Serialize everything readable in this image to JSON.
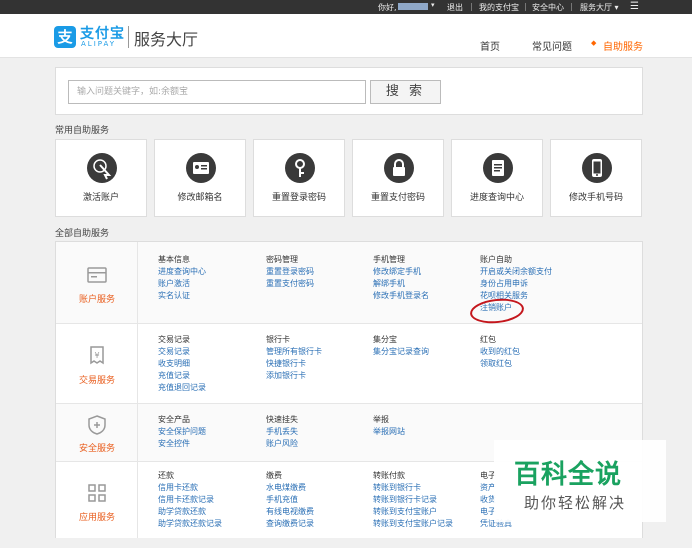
{
  "topbar": {
    "greeting": "你好,",
    "logout": "退出",
    "my_alipay": "我的支付宝",
    "security": "安全中心",
    "service_hall": "服务大厅 ▾",
    "menu_icon": "menu-icon"
  },
  "header": {
    "logo_char": "支",
    "logo_cn": "支付宝",
    "logo_en": "ALIPAY",
    "title": "服务大厅",
    "nav": [
      {
        "label": "首页"
      },
      {
        "label": "常见问题"
      },
      {
        "label": "自助服务",
        "active": true
      }
    ],
    "accent": "#ff6600",
    "brand": "#1a9be6"
  },
  "search": {
    "placeholder": "输入问题关键字，如:余额宝",
    "button": "搜 索"
  },
  "quick": {
    "title": "常用自助服务",
    "tiles": [
      {
        "label": "激活账户",
        "icon": "cursor-click-icon"
      },
      {
        "label": "修改邮箱名",
        "icon": "id-card-icon"
      },
      {
        "label": "重置登录密码",
        "icon": "key-icon"
      },
      {
        "label": "重置支付密码",
        "icon": "lock-icon"
      },
      {
        "label": "进度查询中心",
        "icon": "document-icon"
      },
      {
        "label": "修改手机号码",
        "icon": "phone-icon"
      }
    ]
  },
  "all": {
    "title": "全部自助服务",
    "rows": [
      {
        "category": "账户服务",
        "icon": "account-card-icon",
        "groups": [
          {
            "title": "基本信息",
            "links": [
              "进度查询中心",
              "账户激活",
              "实名认证"
            ]
          },
          {
            "title": "密码管理",
            "links": [
              "重置登录密码",
              "重置支付密码"
            ]
          },
          {
            "title": "手机管理",
            "links": [
              "修改绑定手机",
              "解绑手机",
              "修改手机登录名"
            ]
          },
          {
            "title": "账户自助",
            "links": [
              "开启或关闭余额支付",
              "身份占用申诉",
              "花呗相关服务",
              "注销账户"
            ]
          }
        ]
      },
      {
        "category": "交易服务",
        "icon": "receipt-yen-icon",
        "groups": [
          {
            "title": "交易记录",
            "links": [
              "交易记录",
              "收支明细",
              "充值记录",
              "充值退回记录"
            ]
          },
          {
            "title": "银行卡",
            "links": [
              "管理所有银行卡",
              "快捷银行卡",
              "添加银行卡"
            ]
          },
          {
            "title": "集分宝",
            "links": [
              "集分宝记录查询"
            ]
          },
          {
            "title": "红包",
            "links": [
              "收到的红包",
              "领取红包"
            ]
          }
        ]
      },
      {
        "category": "安全服务",
        "icon": "shield-icon",
        "groups": [
          {
            "title": "安全产品",
            "links": [
              "安全保护问题",
              "安全控件"
            ]
          },
          {
            "title": "快速挂失",
            "links": [
              "手机丢失",
              "账户风险"
            ]
          },
          {
            "title": "举报",
            "links": [
              "举报网站"
            ]
          }
        ]
      },
      {
        "category": "应用服务",
        "icon": "apps-grid-icon",
        "groups": [
          {
            "title": "还款",
            "links": [
              "信用卡还款",
              "信用卡还款记录",
              "助学贷款还款",
              "助学贷款还款记录"
            ]
          },
          {
            "title": "缴费",
            "links": [
              "水电煤缴费",
              "手机充值",
              "有线电视缴费",
              "查询缴费记录"
            ]
          },
          {
            "title": "转账付款",
            "links": [
              "转账到银行卡",
              "转账到银行卡记录",
              "转账到支付宝账户",
              "转账到支付宝账户记录"
            ]
          },
          {
            "title": "电子",
            "links": [
              "资产",
              "收货",
              "电子",
              "凭证验真"
            ]
          }
        ]
      }
    ]
  },
  "watermark": {
    "big": "百科全说",
    "small": "助你轻松解决"
  }
}
